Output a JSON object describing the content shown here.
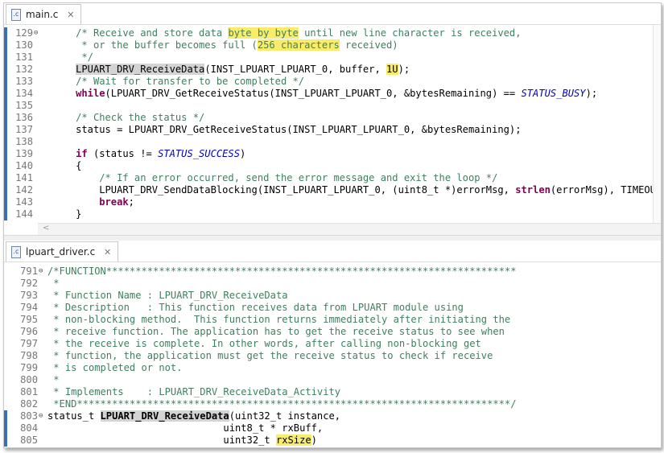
{
  "colors": {
    "comment": "#3f7f5f",
    "keyword": "#7f0055",
    "macro": "#0000c0",
    "highlight": "#f8ec6a",
    "marker": "#3a6fb5"
  },
  "top_editor": {
    "tab": {
      "icon": "c-file-icon",
      "icon_glyph": ".c",
      "title": "main.c",
      "close": "✕"
    },
    "lines": [
      {
        "n": "129",
        "fold": "⊖",
        "tokens": [
          {
            "t": "    "
          },
          {
            "t": "/* Receive and store data ",
            "c": "cm"
          },
          {
            "t": "byte by byte",
            "c": "cm hl"
          },
          {
            "t": " until new line character is received,",
            "c": "cm"
          }
        ]
      },
      {
        "n": "130",
        "tokens": [
          {
            "t": "     "
          },
          {
            "t": "* or the buffer becomes full (",
            "c": "cm"
          },
          {
            "t": "256 characters",
            "c": "cm hl"
          },
          {
            "t": " received)",
            "c": "cm"
          }
        ]
      },
      {
        "n": "131",
        "tokens": [
          {
            "t": "     "
          },
          {
            "t": "*/",
            "c": "cm"
          }
        ]
      },
      {
        "n": "132",
        "tokens": [
          {
            "t": "    "
          },
          {
            "t": "LPUART_DRV_ReceiveData",
            "c": "sel"
          },
          {
            "t": "(INST_LPUART_LPUART_0, buffer, "
          },
          {
            "t": "1U",
            "c": "hl"
          },
          {
            "t": ");"
          }
        ]
      },
      {
        "n": "133",
        "tokens": [
          {
            "t": "    "
          },
          {
            "t": "/* Wait for transfer to be completed */",
            "c": "cm"
          }
        ]
      },
      {
        "n": "134",
        "tokens": [
          {
            "t": "    "
          },
          {
            "t": "while",
            "c": "kw"
          },
          {
            "t": "(LPUART_DRV_GetReceiveStatus(INST_LPUART_LPUART_0, &bytesRemaining) == "
          },
          {
            "t": "STATUS_BUSY",
            "c": "mc"
          },
          {
            "t": ");"
          }
        ]
      },
      {
        "n": "135",
        "tokens": []
      },
      {
        "n": "136",
        "tokens": [
          {
            "t": "    "
          },
          {
            "t": "/* Check the status */",
            "c": "cm"
          }
        ]
      },
      {
        "n": "137",
        "tokens": [
          {
            "t": "    status = LPUART_DRV_GetReceiveStatus(INST_LPUART_LPUART_0, &bytesRemaining);"
          }
        ]
      },
      {
        "n": "138",
        "tokens": []
      },
      {
        "n": "139",
        "tokens": [
          {
            "t": "    "
          },
          {
            "t": "if",
            "c": "kw"
          },
          {
            "t": " (status != "
          },
          {
            "t": "STATUS_SUCCESS",
            "c": "mc"
          },
          {
            "t": ")"
          }
        ]
      },
      {
        "n": "140",
        "tokens": [
          {
            "t": "    {"
          }
        ]
      },
      {
        "n": "141",
        "tokens": [
          {
            "t": "        "
          },
          {
            "t": "/* If an error occurred, send the error message and exit the loop */",
            "c": "cm"
          }
        ]
      },
      {
        "n": "142",
        "tokens": [
          {
            "t": "        LPUART_DRV_SendDataBlocking(INST_LPUART_LPUART_0, (uint8_t *)errorMsg, "
          },
          {
            "t": "strlen",
            "c": "kw"
          },
          {
            "t": "(errorMsg), TIMEOUT);"
          }
        ]
      },
      {
        "n": "143",
        "tokens": [
          {
            "t": "        "
          },
          {
            "t": "break",
            "c": "kw"
          },
          {
            "t": ";"
          }
        ]
      },
      {
        "n": "144",
        "tokens": [
          {
            "t": "    }"
          }
        ]
      }
    ],
    "scroll_left": "<"
  },
  "bottom_editor": {
    "tab": {
      "icon": "c-file-icon",
      "icon_glyph": ".c",
      "title": "lpuart_driver.c",
      "close": "✕"
    },
    "lines": [
      {
        "n": "791",
        "fold": "⊖",
        "tokens": [
          {
            "t": "/*FUNCTION**********************************************************************",
            "c": "cm"
          }
        ]
      },
      {
        "n": "792",
        "tokens": [
          {
            "t": " *",
            "c": "cm"
          }
        ]
      },
      {
        "n": "793",
        "tokens": [
          {
            "t": " * Function Name : LPUART_DRV_ReceiveData",
            "c": "cm"
          }
        ]
      },
      {
        "n": "794",
        "tokens": [
          {
            "t": " * Description   : This function receives data from LPUART module using",
            "c": "cm"
          }
        ]
      },
      {
        "n": "795",
        "tokens": [
          {
            "t": " * non-blocking method.  This function returns immediately after initiating the",
            "c": "cm"
          }
        ]
      },
      {
        "n": "796",
        "tokens": [
          {
            "t": " * receive function. The application has to get the receive status to see when",
            "c": "cm"
          }
        ]
      },
      {
        "n": "797",
        "tokens": [
          {
            "t": " * the receive is complete. In other words, after calling non-blocking get",
            "c": "cm"
          }
        ]
      },
      {
        "n": "798",
        "tokens": [
          {
            "t": " * function, the application must get the receive status to check if receive",
            "c": "cm"
          }
        ]
      },
      {
        "n": "799",
        "tokens": [
          {
            "t": " * is completed or not.",
            "c": "cm"
          }
        ]
      },
      {
        "n": "800",
        "tokens": [
          {
            "t": " *",
            "c": "cm"
          }
        ]
      },
      {
        "n": "801",
        "tokens": [
          {
            "t": " * Implements    : LPUART_DRV_ReceiveData_Activity",
            "c": "cm"
          }
        ]
      },
      {
        "n": "802",
        "tokens": [
          {
            "t": " *END**************************************************************************/",
            "c": "cm"
          }
        ]
      },
      {
        "n": "803",
        "fold": "⊖",
        "tokens": [
          {
            "t": "status_t "
          },
          {
            "t": "LPUART_DRV_ReceiveData",
            "c": "fnb sel"
          },
          {
            "t": "(uint32_t instance,"
          }
        ]
      },
      {
        "n": "804",
        "tokens": [
          {
            "t": "                              uint8_t * rxBuff,"
          }
        ]
      },
      {
        "n": "805",
        "tokens": [
          {
            "t": "                              uint32_t "
          },
          {
            "t": "rxSize",
            "c": "hl"
          },
          {
            "t": ")"
          }
        ]
      }
    ]
  }
}
